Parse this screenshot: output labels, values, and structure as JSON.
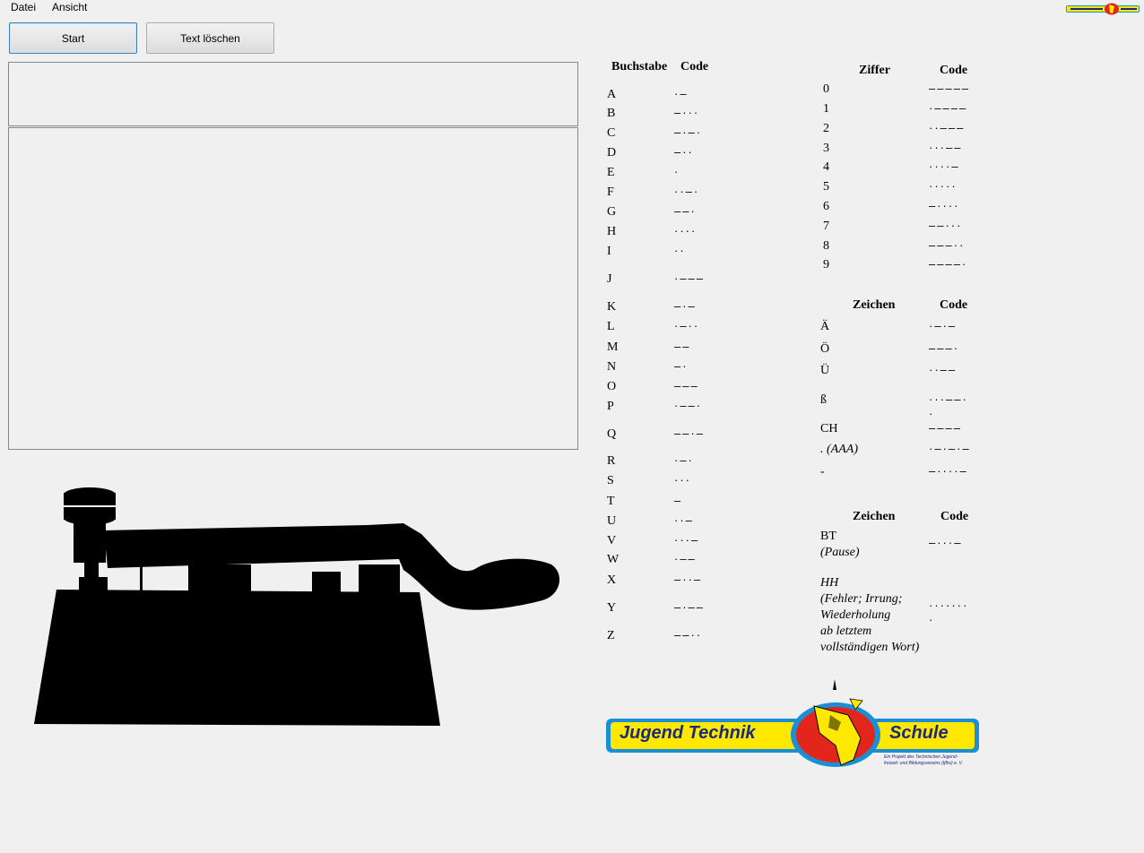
{
  "menu": {
    "file": "Datei",
    "view": "Ansicht"
  },
  "toolbar": {
    "start": "Start",
    "clear": "Text löschen"
  },
  "letters": {
    "header_char": "Buchstabe",
    "header_code": "Code",
    "rows": [
      {
        "char": "A",
        "code": "·–"
      },
      {
        "char": "B",
        "code": "–···"
      },
      {
        "char": "C",
        "code": "–·–·"
      },
      {
        "char": "D",
        "code": "–··"
      },
      {
        "char": "E",
        "code": "·"
      },
      {
        "char": "F",
        "code": "··–·"
      },
      {
        "char": "G",
        "code": "––·"
      },
      {
        "char": "H",
        "code": "····"
      },
      {
        "char": "I",
        "code": "··"
      },
      {
        "char": "J",
        "code": "·–––"
      },
      {
        "char": "K",
        "code": "–·–"
      },
      {
        "char": "L",
        "code": "·–··"
      },
      {
        "char": "M",
        "code": "––"
      },
      {
        "char": "N",
        "code": "–·"
      },
      {
        "char": "O",
        "code": "–––"
      },
      {
        "char": "P",
        "code": "·––·"
      },
      {
        "char": "Q",
        "code": "––·–"
      },
      {
        "char": "R",
        "code": "·–·"
      },
      {
        "char": "S",
        "code": "···"
      },
      {
        "char": "T",
        "code": "–"
      },
      {
        "char": "U",
        "code": "··–"
      },
      {
        "char": "V",
        "code": "···–"
      },
      {
        "char": "W",
        "code": "·––"
      },
      {
        "char": "X",
        "code": "–··–"
      },
      {
        "char": "Y",
        "code": "–·––"
      },
      {
        "char": "Z",
        "code": "––··"
      }
    ]
  },
  "digits": {
    "header_char": "Ziffer",
    "header_code": "Code",
    "rows": [
      {
        "char": "0",
        "code": "–––––"
      },
      {
        "char": "1",
        "code": "·––––"
      },
      {
        "char": "2",
        "code": "··–––"
      },
      {
        "char": "3",
        "code": "···––"
      },
      {
        "char": "4",
        "code": "····–"
      },
      {
        "char": "5",
        "code": "·····"
      },
      {
        "char": "6",
        "code": "–····"
      },
      {
        "char": "7",
        "code": "––···"
      },
      {
        "char": "8",
        "code": "–––··"
      },
      {
        "char": "9",
        "code": "––––·"
      }
    ]
  },
  "signs": {
    "header_char": "Zeichen",
    "header_code": "Code",
    "rows": [
      {
        "char": "Ä",
        "code": "·–·–"
      },
      {
        "char": "Ö",
        "code": "–––·"
      },
      {
        "char": "Ü",
        "code": "··––"
      },
      {
        "char": "ß",
        "code": "···––·\n·"
      },
      {
        "char": "CH",
        "code": "––––"
      },
      {
        "char": ". (AAA)",
        "code": "·–·–·–"
      },
      {
        "char": "-",
        "code": "–····–"
      }
    ]
  },
  "procedural": {
    "header_char": "Zeichen",
    "header_code": "Code",
    "bt_label": "BT",
    "bt_note": "(Pause)",
    "bt_code": "–···–",
    "hh_label": "HH",
    "hh_note_1": "(Fehler; Irrung;",
    "hh_note_2": "Wiederholung",
    "hh_note_3": "ab letztem",
    "hh_note_4": "vollständigen Wort)",
    "hh_code_1": "·······",
    "hh_code_2": "·"
  },
  "logo": {
    "left": "Jugend Technik",
    "right": "Schule",
    "tagline_1": "Ein Projekt des Technischen Jugend-",
    "tagline_2": "freizeit- und Bildungsvereins (tjfbv) e. V.",
    "colors": {
      "yellow": "#ffe800",
      "blue": "#1a8fd6",
      "red": "#e3261b",
      "navy": "#1b2a7a"
    }
  }
}
